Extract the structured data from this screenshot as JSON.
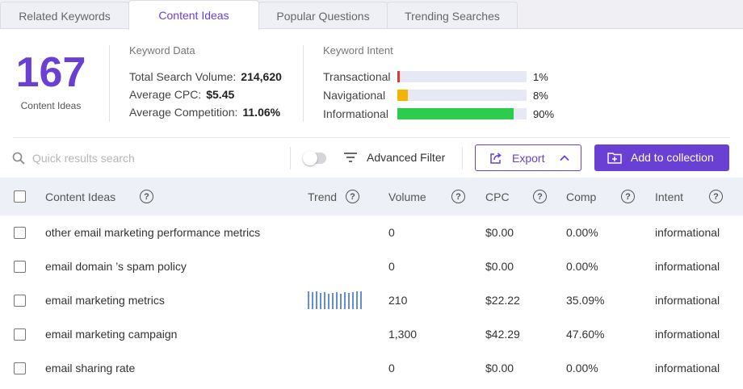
{
  "tabs": [
    {
      "label": "Related Keywords",
      "active": false
    },
    {
      "label": "Content Ideas",
      "active": true
    },
    {
      "label": "Popular Questions",
      "active": false
    },
    {
      "label": "Trending Searches",
      "active": false
    }
  ],
  "summary": {
    "count": "167",
    "count_label": "Content Ideas"
  },
  "keyword_data": {
    "title": "Keyword Data",
    "rows": [
      {
        "label": "Total Search Volume:",
        "value": "214,620"
      },
      {
        "label": "Average CPC:",
        "value": "$5.45"
      },
      {
        "label": "Average Competition:",
        "value": "11.06%"
      }
    ]
  },
  "keyword_intent": {
    "title": "Keyword Intent",
    "rows": [
      {
        "label": "Transactional",
        "pct": "1%",
        "fraction": 0.01,
        "color": "#e5352d"
      },
      {
        "label": "Navigational",
        "pct": "8%",
        "fraction": 0.08,
        "color": "#f5b400"
      },
      {
        "label": "Informational",
        "pct": "90%",
        "fraction": 0.9,
        "color": "#2dcc4f"
      }
    ]
  },
  "toolbar": {
    "search_placeholder": "Quick results search",
    "filter_label": "Advanced Filter",
    "export_label": "Export",
    "add_label": "Add to collection"
  },
  "table": {
    "columns": [
      "Content Ideas",
      "Trend",
      "Volume",
      "CPC",
      "Comp",
      "Intent"
    ],
    "rows": [
      {
        "idea": "other email marketing performance metrics",
        "trend": false,
        "volume": "0",
        "cpc": "$0.00",
        "comp": "0.00%",
        "intent": "informational"
      },
      {
        "idea": "email domain ’s spam policy",
        "trend": false,
        "volume": "0",
        "cpc": "$0.00",
        "comp": "0.00%",
        "intent": "informational"
      },
      {
        "idea": "email marketing metrics",
        "trend": true,
        "volume": "210",
        "cpc": "$22.22",
        "comp": "35.09%",
        "intent": "informational"
      },
      {
        "idea": "email marketing campaign",
        "trend": false,
        "volume": "1,300",
        "cpc": "$42.29",
        "comp": "47.60%",
        "intent": "informational"
      },
      {
        "idea": "email sharing rate",
        "trend": false,
        "volume": "0",
        "cpc": "$0.00",
        "comp": "0.00%",
        "intent": "informational"
      }
    ]
  },
  "colors": {
    "accent": "#6a3fd3",
    "trend_bar": "#3d6fd6"
  },
  "icons": {
    "search": "search-icon",
    "filter": "filter-icon",
    "export": "share-icon",
    "collection": "folder-plus-icon",
    "help": "help-circle-icon",
    "chevron": "chevron-up-icon"
  }
}
